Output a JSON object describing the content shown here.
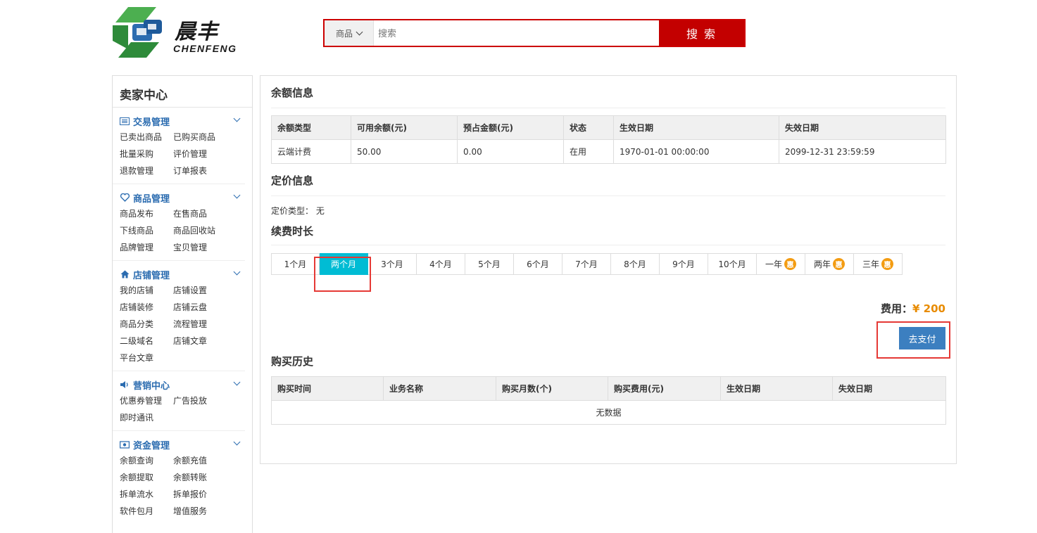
{
  "header": {
    "logo_cn": "晨丰",
    "logo_en": "CHENFENG",
    "search_category": "商品",
    "search_placeholder": "搜索",
    "search_button": "搜 索",
    "colors": {
      "accent_red": "#c30000",
      "logo_green": "#3aa648",
      "logo_blue": "#2b6cb0"
    }
  },
  "sidebar": {
    "title": "卖家中心",
    "groups": [
      {
        "label": "交易管理",
        "icon": "list-icon",
        "links": [
          "已卖出商品",
          "已购买商品",
          "批量采购",
          "评价管理",
          "退款管理",
          "订单报表"
        ]
      },
      {
        "label": "商品管理",
        "icon": "heart-icon",
        "links": [
          "商品发布",
          "在售商品",
          "下线商品",
          "商品回收站",
          "品牌管理",
          "宝贝管理"
        ]
      },
      {
        "label": "店铺管理",
        "icon": "home-icon",
        "links": [
          "我的店铺",
          "店铺设置",
          "店铺装修",
          "店铺云盘",
          "商品分类",
          "流程管理",
          "二级域名",
          "店铺文章",
          "平台文章"
        ]
      },
      {
        "label": "营销中心",
        "icon": "speaker-icon",
        "links": [
          "优惠券管理",
          "广告投放",
          "即时通讯"
        ]
      },
      {
        "label": "资金管理",
        "icon": "money-icon",
        "links": [
          "余额查询",
          "余额充值",
          "余额提取",
          "余额转账",
          "拆单流水",
          "拆单报价",
          "软件包月",
          "增值服务"
        ]
      }
    ]
  },
  "balance": {
    "title": "余额信息",
    "headers": [
      "余额类型",
      "可用余额(元)",
      "预占金额(元)",
      "状态",
      "生效日期",
      "失效日期"
    ],
    "rows": [
      [
        "云端计费",
        "50.00",
        "0.00",
        "在用",
        "1970-01-01 00:00:00",
        "2099-12-31 23:59:59"
      ]
    ]
  },
  "pricing": {
    "title": "定价信息",
    "type_label": "定价类型：",
    "type_value": "无"
  },
  "renewal": {
    "title": "续费时长",
    "options": [
      {
        "label": "1个月",
        "discount": ""
      },
      {
        "label": "两个月",
        "discount": ""
      },
      {
        "label": "3个月",
        "discount": ""
      },
      {
        "label": "4个月",
        "discount": ""
      },
      {
        "label": "5个月",
        "discount": ""
      },
      {
        "label": "6个月",
        "discount": ""
      },
      {
        "label": "7个月",
        "discount": ""
      },
      {
        "label": "8个月",
        "discount": ""
      },
      {
        "label": "9个月",
        "discount": ""
      },
      {
        "label": "10个月",
        "discount": ""
      },
      {
        "label": "一年",
        "discount": "惠"
      },
      {
        "label": "两年",
        "discount": "惠"
      },
      {
        "label": "三年",
        "discount": "惠"
      }
    ],
    "selected_index": 1,
    "fee_label": "费用：",
    "fee_amount": "¥ 200",
    "pay_button": "去支付"
  },
  "history": {
    "title": "购买历史",
    "headers": [
      "购买时间",
      "业务名称",
      "购买月数(个)",
      "购买费用(元)",
      "生效日期",
      "失效日期"
    ],
    "empty_text": "无数据"
  }
}
